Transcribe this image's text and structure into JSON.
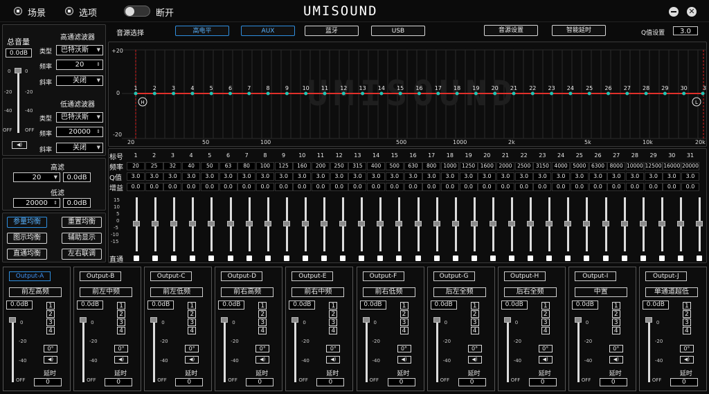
{
  "topbar": {
    "scene": "场景",
    "options": "选项",
    "toggle_label": "断开",
    "logo": "UMISOUND"
  },
  "source": {
    "label": "音源选择",
    "buttons": [
      "高电平",
      "AUX",
      "蓝牙",
      "USB"
    ],
    "active": 0,
    "source_settings": "音源设置",
    "smart_delay": "智能延时",
    "q_label": "Q值设置",
    "q_value": "3.0"
  },
  "master": {
    "title": "总音量",
    "value": "0.0dB",
    "scale": [
      "0",
      "-20",
      "-40",
      "OFF"
    ]
  },
  "hpf": {
    "title": "高通滤波器",
    "type_label": "类型",
    "type": "巴特沃斯",
    "freq_label": "频率",
    "freq": "20",
    "slope_label": "斜率",
    "slope": "关闭"
  },
  "lpf": {
    "title": "低通滤波器",
    "type_label": "类型",
    "type": "巴特沃斯",
    "freq_label": "频率",
    "freq": "20000",
    "slope_label": "斜率",
    "slope": "关闭"
  },
  "hl": {
    "high_label": "高滤",
    "high_freq": "20",
    "high_gain": "0.0dB",
    "low_label": "低滤",
    "low_freq": "20000",
    "low_gain": "0.0dB"
  },
  "eqbuttons": [
    "参量均衡",
    "重置均衡",
    "图示均衡",
    "辅助显示",
    "直通均衡",
    "左右联调"
  ],
  "graph": {
    "y_labels": [
      "+20",
      "0",
      "-20"
    ],
    "x_labels": [
      "20",
      "50",
      "100",
      "500",
      "1000",
      "2k",
      "5k",
      "10k",
      "20k"
    ],
    "watermark": "UMISOUND",
    "h_marker": "H",
    "l_marker": "L"
  },
  "table": {
    "labels": [
      "标号",
      "频率",
      "Q值",
      "增益"
    ],
    "bands": [
      "1",
      "2",
      "3",
      "4",
      "5",
      "6",
      "7",
      "8",
      "9",
      "10",
      "11",
      "12",
      "13",
      "14",
      "15",
      "16",
      "17",
      "18",
      "19",
      "20",
      "21",
      "22",
      "23",
      "24",
      "25",
      "26",
      "27",
      "28",
      "29",
      "30",
      "31"
    ],
    "freqs": [
      "20",
      "25",
      "32",
      "40",
      "50",
      "63",
      "80",
      "100",
      "125",
      "160",
      "200",
      "250",
      "315",
      "400",
      "500",
      "630",
      "800",
      "1000",
      "1250",
      "1600",
      "2000",
      "2500",
      "3150",
      "4000",
      "5000",
      "6300",
      "8000",
      "10000",
      "12500",
      "16000",
      "20000"
    ],
    "q": "3.0",
    "gain": "0.0"
  },
  "sliders": {
    "scale": [
      "15",
      "10",
      "5",
      "0",
      "-5",
      "-10",
      "-15"
    ],
    "bypass_label": "直通"
  },
  "outputs": [
    {
      "title": "Output-A",
      "name": "前左高频",
      "gain": "0.0dB",
      "delay": "0"
    },
    {
      "title": "Output-B",
      "name": "前左中频",
      "gain": "0.0dB",
      "delay": "0"
    },
    {
      "title": "Output-C",
      "name": "前左低频",
      "gain": "0.0dB",
      "delay": "0"
    },
    {
      "title": "Output-D",
      "name": "前右高频",
      "gain": "0.0dB",
      "delay": "0"
    },
    {
      "title": "Output-E",
      "name": "前右中频",
      "gain": "0.0dB",
      "delay": "0"
    },
    {
      "title": "Output-F",
      "name": "前右低频",
      "gain": "0.0dB",
      "delay": "0"
    },
    {
      "title": "Output-G",
      "name": "后左全频",
      "gain": "0.0dB",
      "delay": "0"
    },
    {
      "title": "Output-H",
      "name": "后右全频",
      "gain": "0.0dB",
      "delay": "0"
    },
    {
      "title": "Output-I",
      "name": "中置",
      "gain": "0.0dB",
      "delay": "0"
    },
    {
      "title": "Output-J",
      "name": "单通道超低",
      "gain": "0.0dB",
      "delay": "0"
    }
  ],
  "output_common": {
    "channels": [
      "1",
      "2",
      "3",
      "4"
    ],
    "phase": "0°",
    "delay_label": "延时",
    "scale": [
      "0",
      "-20",
      "-40",
      "OFF"
    ]
  },
  "colors": {
    "accent": "#2f8fe0",
    "curve": "#e0302a",
    "point": "#25c4b4",
    "marker_line": "#d82020"
  }
}
